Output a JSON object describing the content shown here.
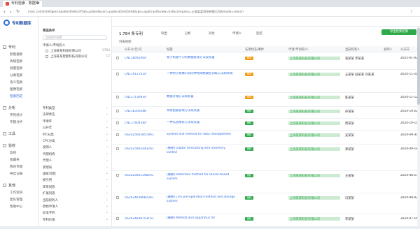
{
  "browser": {
    "tab_title": "专利检索 · 数据库",
    "tab_close": "×",
    "url": "inssc.com/intelligence/patent/detail?tab=patent&sort=publicationDate&type=applicant&view=list&company=上海某某科技有限公司&mode=search"
  },
  "sidebar": {
    "logo_text": "专利数据库",
    "groups": [
      {
        "label": "专利",
        "items": [
          "智能搜索",
          "高级检索",
          "批量检索",
          "分类检索",
          "语义检索",
          "图像检索",
          "检索历史"
        ],
        "active_index": 6
      },
      {
        "label": "分析",
        "items": [
          "专利统计",
          "专题分析"
        ]
      },
      {
        "label": "工具",
        "items": []
      },
      {
        "label": "监控",
        "items": [
          "监控",
          "收藏夹",
          "我的专题",
          "导出记录"
        ]
      },
      {
        "label": "其他",
        "items": [
          "工作空间",
          "团队管理",
          "帮助中心"
        ]
      }
    ]
  },
  "breadcrumb": "检索结果 > 申请人 > 上海某某科技有限公司",
  "filter": {
    "header": "筛选条件",
    "search_placeholder": "在结果中搜索",
    "tree_title": "申请人/专利权人",
    "tree_items": [
      {
        "label": "上海某某科技有限公司",
        "count": "1784"
      },
      {
        "label": "上海某某智能科技有限公司",
        "count": "12"
      }
    ],
    "facets": [
      "专利类型",
      "法律状态",
      "申请年",
      "公开年",
      "IPC分类",
      "CPC分类",
      "发明人",
      "代理机构",
      "代理人",
      "受理局",
      "国家/地区",
      "被引用",
      "简单同族",
      "扩展同族",
      "当前权利人",
      "原始申请人",
      "标准专利",
      "专利价值",
      "技术领域"
    ]
  },
  "results": {
    "count_label": "1,784 条专利",
    "tools": [
      "导出",
      "分析",
      "对比",
      "申请人",
      "监控"
    ],
    "green_button": "导出检索结果",
    "view_label": "列表视图",
    "columns": [
      "公开(公告)号",
      "标题",
      "法律状态/事件",
      "申请(专利权)人",
      "当前权利人",
      "发明人",
      "公开日"
    ],
    "rows": [
      {
        "pn": "CN11804200A",
        "title": "基于机器学习的数据处理方法及装置",
        "status": "审中",
        "applicant": "上海某某科技有限公司",
        "inventor": "张某某 李某某",
        "date": "2025-01-02"
      },
      {
        "pn": "CN11912743A",
        "title": "一种用于图像识别的神经网络模型训练方法和系统",
        "status": "审中",
        "applicant": "上海某某科技有限公司",
        "inventor": "王某某 赵某某 刘某某",
        "date": "2024-11-21"
      },
      {
        "pn": "CN11713693A",
        "title": "数据存储方法和装置",
        "status": "审中",
        "applicant": "上海某某科技有限公司",
        "inventor": "陈某某",
        "date": "2024-11-12"
      },
      {
        "pn": "CN11835028B",
        "title": "系统配置管理方法及装置",
        "status": "授权",
        "applicant": "上海某某科技有限公司",
        "inventor": "孙某某",
        "date": "2024-10-22"
      },
      {
        "pn": "CN11760458A",
        "title": "一种信息推荐方法及装置",
        "status": "授权",
        "applicant": "上海某某科技有限公司",
        "inventor": "周某某",
        "date": "2024-10-11"
      },
      {
        "pn": "US20250028578A1",
        "title": "System and method for data management",
        "status": "授权",
        "applicant": "上海某某科技有限公司",
        "inventor": "吴某某",
        "date": "2024-09-30"
      },
      {
        "pn": "US20250024432A1",
        "title": "[摘要] Digital forecasting and inventory control",
        "status": "授权",
        "applicant": "上海某某科技有限公司",
        "inventor": "郑某某",
        "date": "2024-09-18"
      },
      {
        "pn": "US20250013982A1",
        "title": "[摘要] Detection method for sensor-based system",
        "status": "授权",
        "applicant": "上海某某科技有限公司",
        "inventor": "王某某",
        "date": "2024-08-27"
      },
      {
        "pn": "US20240396823A1",
        "title": "[摘要] Link pre-operation method and storage system",
        "status": "授权",
        "applicant": "上海某某科技有限公司",
        "inventor": "冯某某",
        "date": "2024-08-02"
      },
      {
        "pn": "US20240387531A1",
        "title": "[摘要] Method and apparatus for",
        "status": "授权",
        "applicant": "上海某某科技有限公司",
        "inventor": "李某某",
        "date": "2024-07-16"
      }
    ]
  },
  "colors": {
    "accent": "#2d6cdf",
    "green": "#2eaa4a",
    "orange": "#f39c12"
  }
}
